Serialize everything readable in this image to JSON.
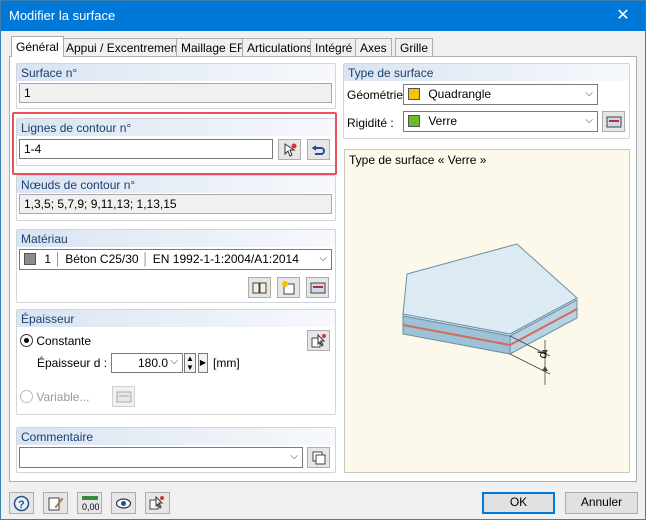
{
  "window": {
    "title": "Modifier la surface",
    "close_glyph": "✕"
  },
  "tabs": [
    {
      "label": "Général"
    },
    {
      "label": "Appui / Excentrement"
    },
    {
      "label": "Maillage EF"
    },
    {
      "label": "Articulations"
    },
    {
      "label": "Intégré"
    },
    {
      "label": "Axes"
    },
    {
      "label": "Grille"
    }
  ],
  "surface_no": {
    "header": "Surface n°",
    "value": "1"
  },
  "boundary_lines": {
    "header": "Lignes de contour n°",
    "value": "1-4"
  },
  "boundary_nodes": {
    "header": "Nœuds de contour n°",
    "value": "1,3,5; 5,7,9; 9,11,13; 1,13,15"
  },
  "material": {
    "header": "Matériau",
    "number": "1",
    "name": "Béton C25/30",
    "standard": "EN 1992-1-1:2004/A1:2014",
    "swatch_color": "#8c8c8c"
  },
  "thickness": {
    "header": "Épaisseur",
    "constant_label": "Constante",
    "thickness_label": "Épaisseur d :",
    "thickness_value": "180.0",
    "unit": "[mm]",
    "variable_label": "Variable..."
  },
  "comment": {
    "header": "Commentaire",
    "value": ""
  },
  "surface_type": {
    "header": "Type de surface",
    "geometry_label": "Géométrie :",
    "geometry_value": "Quadrangle",
    "geometry_color": "#f5c400",
    "stiffness_label": "Rigidité :",
    "stiffness_value": "Verre",
    "stiffness_color": "#6fb92c"
  },
  "preview": {
    "caption": "Type de surface « Verre »",
    "dim_label": "d"
  },
  "buttons": {
    "ok": "OK",
    "cancel": "Annuler"
  }
}
